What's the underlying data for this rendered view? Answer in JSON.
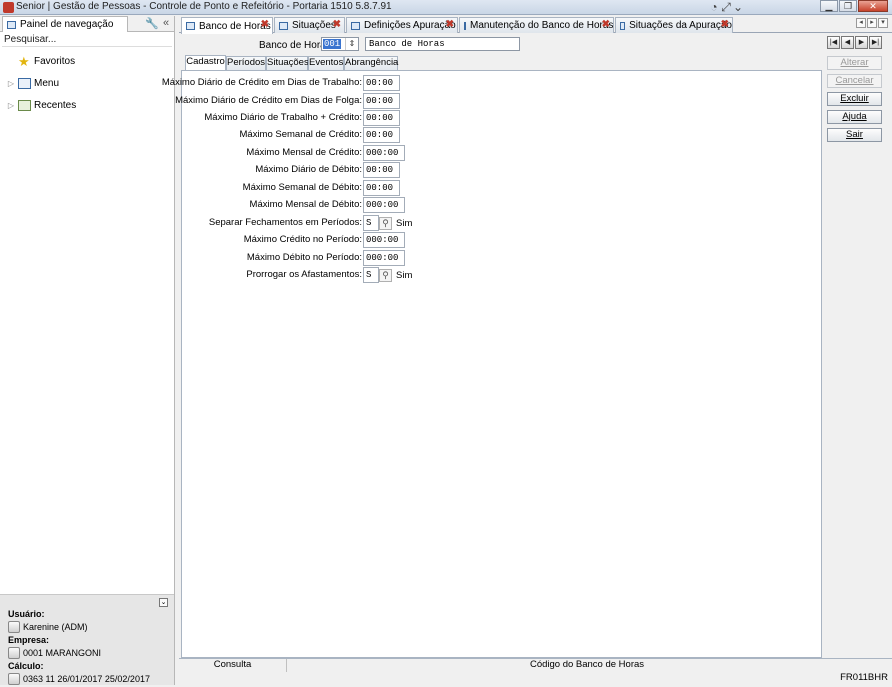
{
  "window": {
    "title": "Senior | Gestão de Pessoas - Controle de Ponto e Refeitório - Portaria 1510 5.8.7.91"
  },
  "left_panel": {
    "tab_label": "Painel de navegação",
    "search_placeholder": "Pesquisar...",
    "items": [
      {
        "label": "Favoritos",
        "icon": "star-icon"
      },
      {
        "label": "Menu",
        "icon": "menu-icon"
      },
      {
        "label": "Recentes",
        "icon": "recent-icon"
      }
    ],
    "footer": {
      "user_label": "Usuário:",
      "user_value": "Karenine (ADM)",
      "company_label": "Empresa:",
      "company_value": "0001  MARANGONI",
      "calc_label": "Cálculo:",
      "calc_value": "0363  11  26/01/2017  25/02/2017"
    }
  },
  "tabs": [
    {
      "label": "Banco de Horas",
      "active": true
    },
    {
      "label": "Situações",
      "active": false
    },
    {
      "label": "Definições Apuração",
      "active": false
    },
    {
      "label": "Manutenção do Banco de Horas",
      "active": false
    },
    {
      "label": "Situações da Apuração",
      "active": false
    }
  ],
  "header": {
    "label": "Banco de Horas:",
    "code": "001",
    "description": "Banco de Horas"
  },
  "subtabs": [
    "Cadastro",
    "Períodos",
    "Situações",
    "Eventos",
    "Abrangência"
  ],
  "fields": [
    {
      "label": "Máximo Diário de Crédito em Dias de Trabalho:",
      "value": "00:00"
    },
    {
      "label": "Máximo Diário de Crédito em Dias de Folga:",
      "value": "00:00"
    },
    {
      "label": "Máximo Diário de Trabalho + Crédito:",
      "value": "00:00"
    },
    {
      "label": "Máximo Semanal de Crédito:",
      "value": "00:00"
    },
    {
      "label": "Máximo Mensal de Crédito:",
      "value": "000:00"
    },
    {
      "label": "Máximo Diário de Débito:",
      "value": "00:00"
    },
    {
      "label": "Máximo Semanal de Débito:",
      "value": "00:00"
    },
    {
      "label": "Máximo Mensal de Débito:",
      "value": "000:00"
    },
    {
      "label": "Separar Fechamentos em Períodos:",
      "value": "S",
      "extra": "Sim"
    },
    {
      "label": "Máximo Crédito no Período:",
      "value": "000:00"
    },
    {
      "label": "Máximo Débito no Período:",
      "value": "000:00"
    },
    {
      "label": "Prorrogar os Afastamentos:",
      "value": "S",
      "extra": "Sim"
    }
  ],
  "actions": {
    "alterar": "Alterar",
    "cancelar": "Cancelar",
    "excluir": "Excluir",
    "ajuda": "Ajuda",
    "sair": "Sair"
  },
  "status": {
    "mode": "Consulta",
    "field": "Código do Banco de Horas",
    "form_code": "FR011BHR"
  }
}
